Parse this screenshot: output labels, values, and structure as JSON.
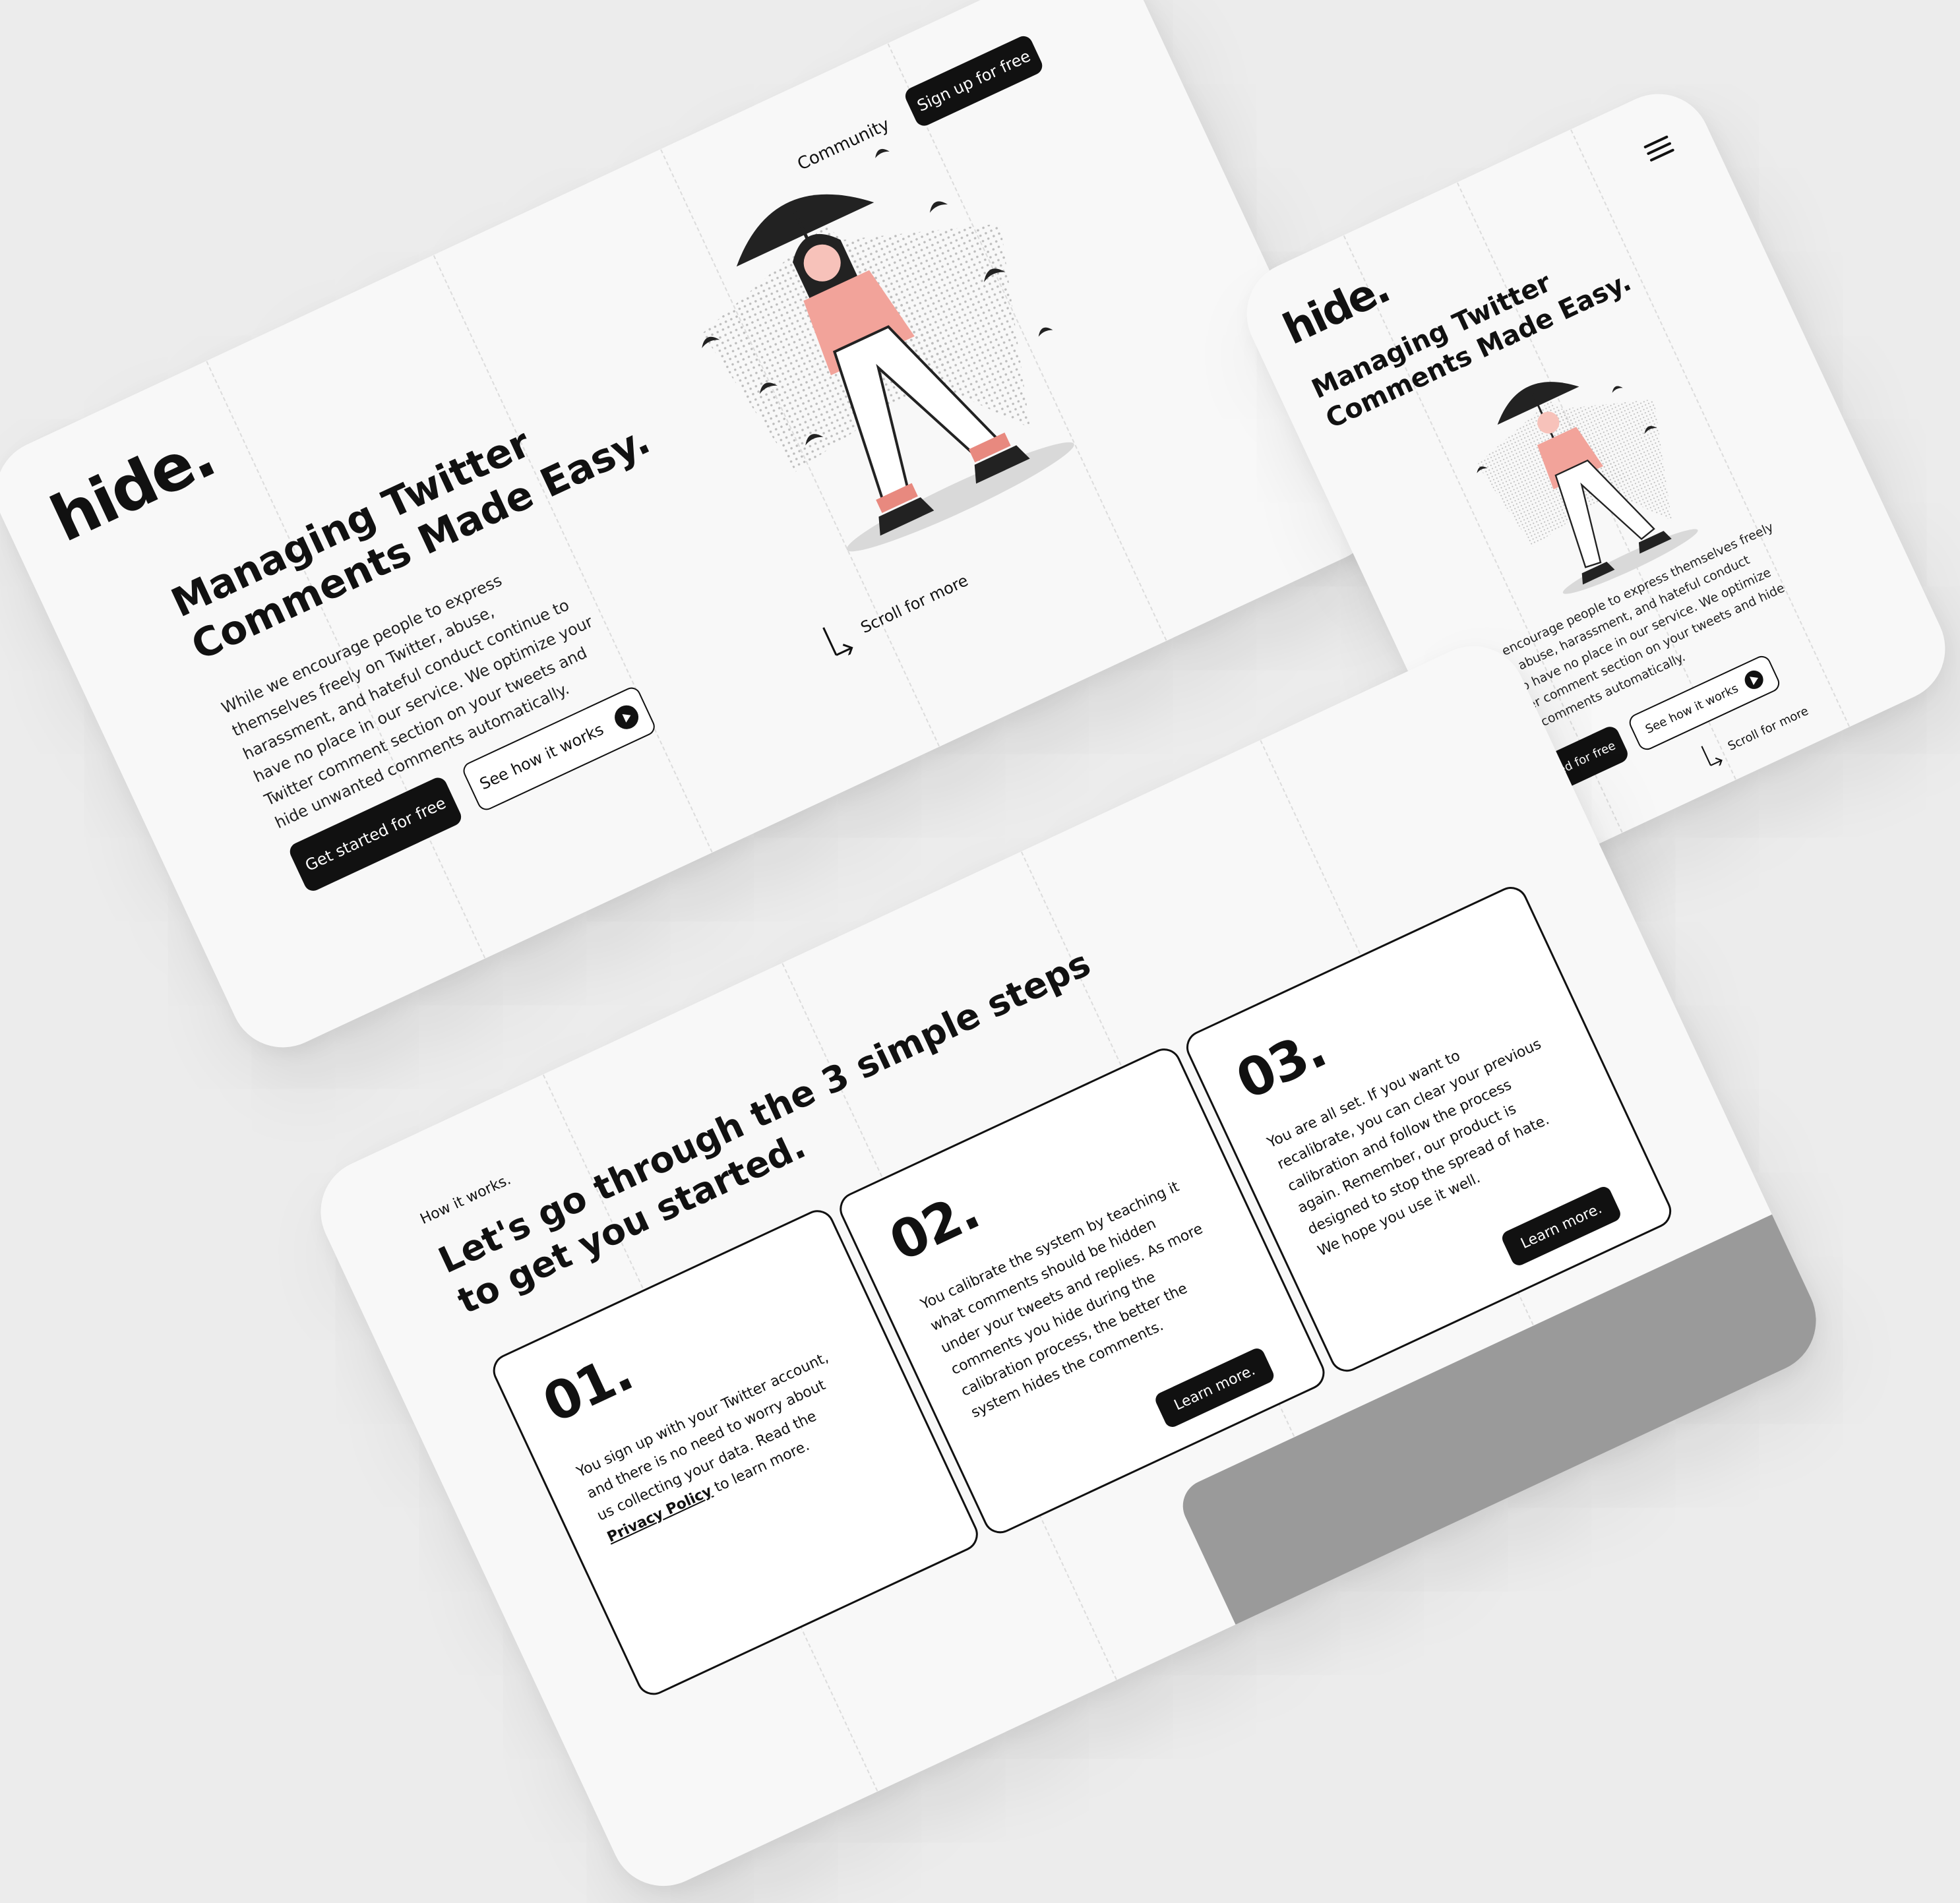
{
  "hero": {
    "logo": "hide.",
    "nav_community": "Community",
    "nav_signup": "Sign up for free",
    "title_line1": "Managing Twitter",
    "title_line2": "Comments Made Easy.",
    "description": "While we encourage people to express themselves freely on Twitter, abuse, harassment, and hateful conduct continue to have no place in our service. We optimize your Twitter comment section on your tweets and hide unwanted comments automatically.",
    "cta_primary": "Get started for free",
    "cta_secondary": "See how it works",
    "scroll_hint": "Scroll for more"
  },
  "mobile": {
    "logo": "hide.",
    "title_line1": "Managing Twitter",
    "title_line2": "Comments Made Easy.",
    "description": "While we encourage people to express themselves freely on Twitter, abuse, harassment, and hateful conduct continue to have no place in our service. We optimize your Twitter comment section on your tweets and hide unwanted comments automatically.",
    "cta_primary": "Get started for free",
    "cta_secondary": "See how it works",
    "scroll_hint": "Scroll for more"
  },
  "how": {
    "eyebrow": "How it works.",
    "title_line1": "Let's go through the 3 simple steps",
    "title_line2": "to get you started.",
    "steps": [
      {
        "num": "01.",
        "text": "You sign up with your Twitter account, and there is no need to worry about us collecting your data. Read the",
        "link": "Privacy Policy",
        "tail": "to learn more."
      },
      {
        "num": "02.",
        "text": "You calibrate the system by teaching it what comments should be hidden under your tweets and replies. As more comments you hide during the calibration process, the better the system hides the comments.",
        "button": "Learn more."
      },
      {
        "num": "03.",
        "text": "You are all set. If you want to recalibrate, you can clear your previous calibration and follow the process again. Remember, our product is designed to stop the spread of hate. We hope you use it well.",
        "button": "Learn more."
      }
    ]
  },
  "colors": {
    "background": "#ececec",
    "card": "#f8f8f8",
    "ink": "#111111",
    "accent_skin": "#f2a39a",
    "accent_pink": "#e8897f"
  },
  "icons": [
    "menu-icon",
    "play-icon",
    "arrow-down-icon",
    "umbrella-illustration",
    "bird-icon"
  ]
}
